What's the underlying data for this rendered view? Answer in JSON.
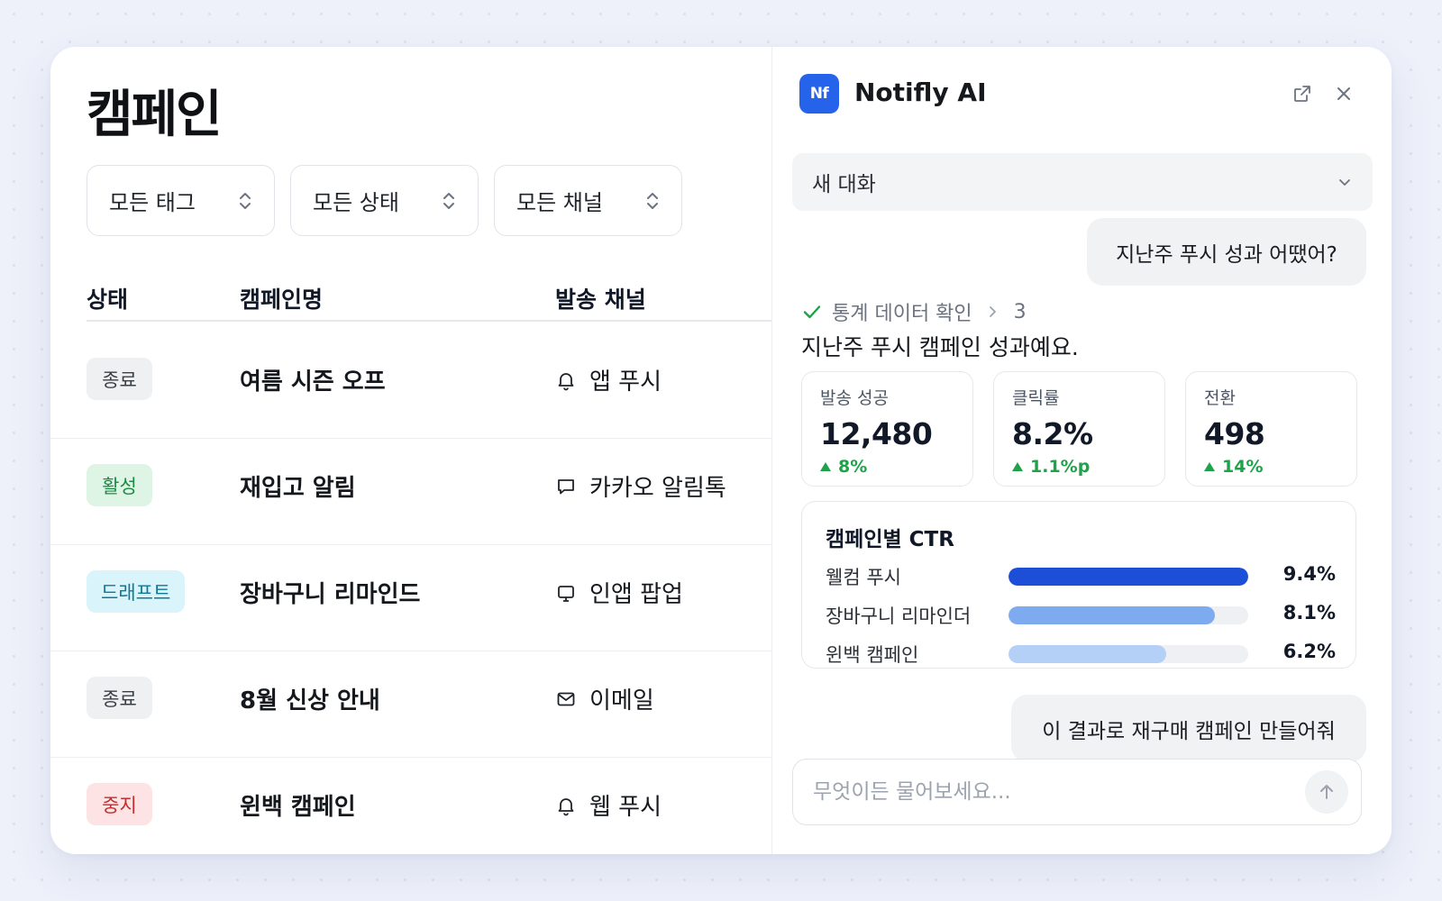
{
  "colors": {
    "accent": "#2563eb",
    "success": "#1fa24a",
    "bar_primary": "#1d4ed8",
    "bar_secondary": "#7eaaf0",
    "bar_tertiary": "#b5d0f7"
  },
  "campaigns": {
    "title": "캠페인",
    "filters": [
      "모든 태그",
      "모든 상태",
      "모든 채널"
    ],
    "columns": {
      "status": "상태",
      "name": "캠페인명",
      "channel": "발송 채널"
    },
    "rows": [
      {
        "status": "종료",
        "status_type": "ended",
        "name": "여름 시즌 오프",
        "channel": "앱 푸시",
        "channel_icon": "bell-icon"
      },
      {
        "status": "활성",
        "status_type": "active",
        "name": "재입고 알림",
        "channel": "카카오 알림톡",
        "channel_icon": "chat-bubble-icon"
      },
      {
        "status": "드래프트",
        "status_type": "draft",
        "name": "장바구니 리마인드",
        "channel": "인앱 팝업",
        "channel_icon": "popup-icon"
      },
      {
        "status": "종료",
        "status_type": "ended",
        "name": "8월 신상 안내",
        "channel": "이메일",
        "channel_icon": "mail-icon"
      },
      {
        "status": "중지",
        "status_type": "stopped",
        "name": "윈백 캠페인",
        "channel": "웹 푸시",
        "channel_icon": "bell-icon"
      }
    ]
  },
  "assistant": {
    "logo_text": "Nf",
    "title": "Notifly AI",
    "conversation_select": "새 대화",
    "user_message_1": "지난주 푸시 성과 어땠어?",
    "step": {
      "label": "통계 데이터 확인",
      "count": "3"
    },
    "answer_text": "지난주 푸시 캠페인 성과예요.",
    "stats": [
      {
        "label": "발송 성공",
        "value": "12,480",
        "delta": "8%"
      },
      {
        "label": "클릭률",
        "value": "8.2%",
        "delta": "1.1%p"
      },
      {
        "label": "전환",
        "value": "498",
        "delta": "14%"
      }
    ],
    "ctr": {
      "title": "캠페인별 CTR",
      "rows": [
        {
          "label": "웰컴 푸시",
          "value_text": "9.4%",
          "value": 9.4
        },
        {
          "label": "장바구니 리마인더",
          "value_text": "8.1%",
          "value": 8.1
        },
        {
          "label": "윈백 캠페인",
          "value_text": "6.2%",
          "value": 6.2
        }
      ]
    },
    "user_message_2": "이 결과로 재구매 캠페인 만들어줘",
    "input_placeholder": "무엇이든 물어보세요..."
  }
}
